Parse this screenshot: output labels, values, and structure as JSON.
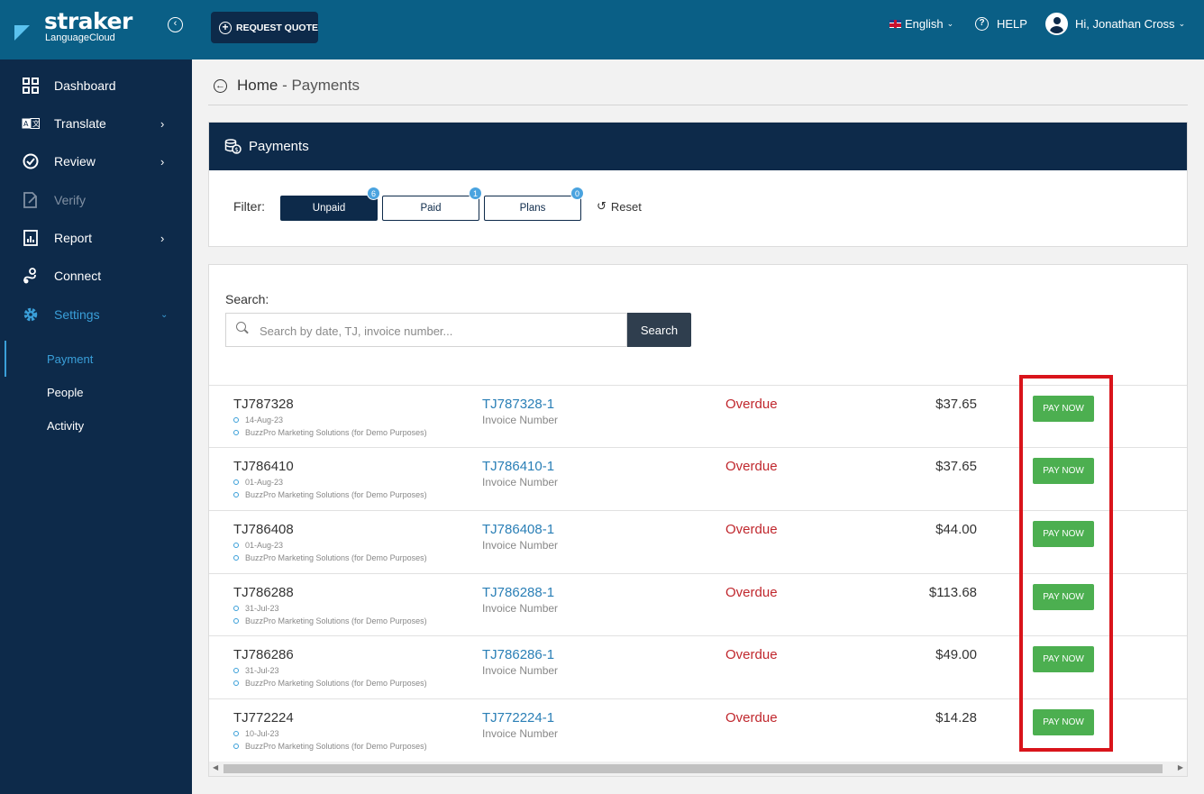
{
  "header": {
    "brand": "straker",
    "brand_sub": "LanguageCloud",
    "request_quote": "REQUEST QUOTE",
    "language": "English",
    "help": "HELP",
    "user": "Hi, Jonathan Cross"
  },
  "sidebar": {
    "items": [
      {
        "label": "Dashboard",
        "icon": "grid-icon"
      },
      {
        "label": "Translate",
        "icon": "translate-icon"
      },
      {
        "label": "Review",
        "icon": "check-circle-icon"
      },
      {
        "label": "Verify",
        "icon": "verify-doc-icon"
      },
      {
        "label": "Report",
        "icon": "report-icon"
      },
      {
        "label": "Connect",
        "icon": "connect-icon"
      },
      {
        "label": "Settings",
        "icon": "gear-icon"
      }
    ],
    "sub_items": [
      "Payment",
      "People",
      "Activity"
    ]
  },
  "breadcrumb": {
    "home": "Home",
    "sep": " - ",
    "current": "Payments"
  },
  "payments": {
    "title": "Payments",
    "filter_label": "Filter:",
    "filters": [
      {
        "label": "Unpaid",
        "count": "6"
      },
      {
        "label": "Paid",
        "count": "1"
      },
      {
        "label": "Plans",
        "count": "0"
      }
    ],
    "reset": "Reset"
  },
  "search": {
    "label": "Search:",
    "placeholder": "Search by date, TJ, invoice number...",
    "button": "Search"
  },
  "rows": [
    {
      "tj": "TJ787328",
      "date": "14-Aug-23",
      "company": "BuzzPro Marketing Solutions (for Demo Purposes)",
      "invoice": "TJ787328-1",
      "invoice_label": "Invoice Number",
      "status": "Overdue",
      "amount": "$37.65",
      "action": "PAY NOW"
    },
    {
      "tj": "TJ786410",
      "date": "01-Aug-23",
      "company": "BuzzPro Marketing Solutions (for Demo Purposes)",
      "invoice": "TJ786410-1",
      "invoice_label": "Invoice Number",
      "status": "Overdue",
      "amount": "$37.65",
      "action": "PAY NOW"
    },
    {
      "tj": "TJ786408",
      "date": "01-Aug-23",
      "company": "BuzzPro Marketing Solutions (for Demo Purposes)",
      "invoice": "TJ786408-1",
      "invoice_label": "Invoice Number",
      "status": "Overdue",
      "amount": "$44.00",
      "action": "PAY NOW"
    },
    {
      "tj": "TJ786288",
      "date": "31-Jul-23",
      "company": "BuzzPro Marketing Solutions (for Demo Purposes)",
      "invoice": "TJ786288-1",
      "invoice_label": "Invoice Number",
      "status": "Overdue",
      "amount": "$113.68",
      "action": "PAY NOW"
    },
    {
      "tj": "TJ786286",
      "date": "31-Jul-23",
      "company": "BuzzPro Marketing Solutions (for Demo Purposes)",
      "invoice": "TJ786286-1",
      "invoice_label": "Invoice Number",
      "status": "Overdue",
      "amount": "$49.00",
      "action": "PAY NOW"
    },
    {
      "tj": "TJ772224",
      "date": "10-Jul-23",
      "company": "BuzzPro Marketing Solutions (for Demo Purposes)",
      "invoice": "TJ772224-1",
      "invoice_label": "Invoice Number",
      "status": "Overdue",
      "amount": "$14.28",
      "action": "PAY NOW"
    }
  ],
  "colors": {
    "topbar": "#0a5f86",
    "navy": "#0d2a4a",
    "accent": "#3a9fd9",
    "overdue": "#c0272d",
    "pay_now": "#4caf50",
    "highlight": "#d9141b"
  }
}
